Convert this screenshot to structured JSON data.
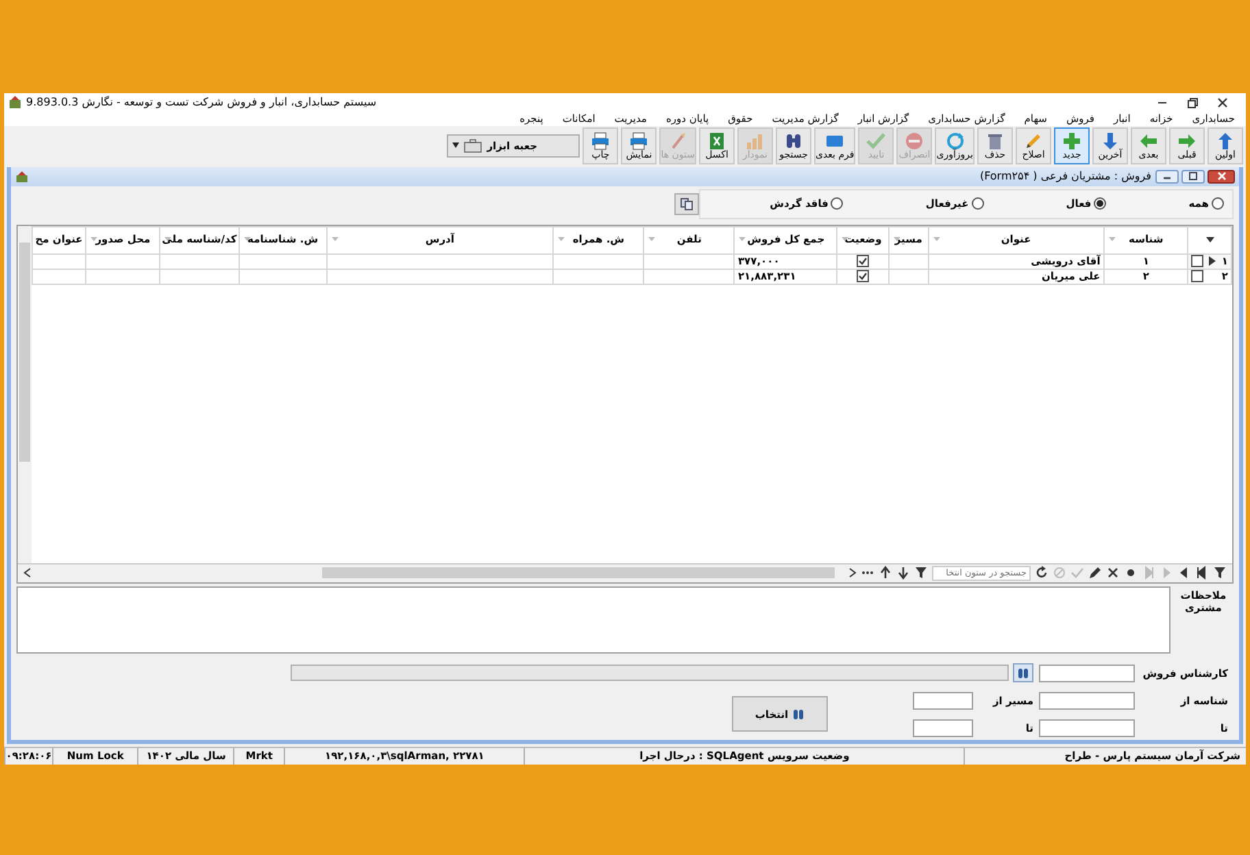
{
  "window": {
    "title": "سیستم حسابداری، انبار و فروش شرکت تست و توسعه - نگارش 9.893.0.3"
  },
  "menu": [
    "حسابداری",
    "خزانه",
    "انبار",
    "فروش",
    "سهام",
    "گزارش حسابداری",
    "گزارش انبار",
    "گزارش مدیریت",
    "حقوق",
    "پایان دوره",
    "مدیریت",
    "امکانات",
    "پنجره"
  ],
  "toolbar": [
    {
      "label": "اولین",
      "disabled": false,
      "selected": false
    },
    {
      "label": "قبلی",
      "disabled": false,
      "selected": false
    },
    {
      "label": "بعدی",
      "disabled": false,
      "selected": false
    },
    {
      "label": "آخرین",
      "disabled": false,
      "selected": false
    },
    {
      "label": "جدید",
      "disabled": false,
      "selected": true
    },
    {
      "label": "اصلاح",
      "disabled": false,
      "selected": false
    },
    {
      "label": "حذف",
      "disabled": false,
      "selected": false
    },
    {
      "label": "بروزآوری",
      "disabled": false,
      "selected": false
    },
    {
      "label": "انصراف",
      "disabled": true,
      "selected": false
    },
    {
      "label": "تایید",
      "disabled": true,
      "selected": false
    },
    {
      "label": "فرم بعدی",
      "disabled": false,
      "selected": false
    },
    {
      "label": "جستجو",
      "disabled": false,
      "selected": false
    },
    {
      "label": "نمودار",
      "disabled": true,
      "selected": false
    },
    {
      "label": "اکسل",
      "disabled": false,
      "selected": false
    },
    {
      "label": "ستون ها",
      "disabled": true,
      "selected": false
    },
    {
      "label": "نمایش",
      "disabled": false,
      "selected": false
    },
    {
      "label": "چاپ",
      "disabled": false,
      "selected": false
    }
  ],
  "toolbox": {
    "label": "جعبه ابزار"
  },
  "form": {
    "title": "فروش : مشتریان فرعی ( Form۲۵۴)",
    "filters": [
      {
        "label": "همه",
        "selected": false
      },
      {
        "label": "فعال",
        "selected": true
      },
      {
        "label": "غیرفعال",
        "selected": false
      },
      {
        "label": "فاقد گردش",
        "selected": false
      }
    ],
    "columns": [
      "شناسه",
      "عنوان",
      "مسیر",
      "وضعیت",
      "جمع کل فروش",
      "تلفن",
      "ش. همراه",
      "آدرس",
      "ش. شناسنامه",
      "کد/شناسه ملی",
      "محل صدور",
      "عنوان مح"
    ],
    "rows": [
      {
        "number": "۱",
        "current": true,
        "checked": false,
        "id": "۱",
        "title": "آقای درویشی",
        "active": true,
        "total": "۳۷۷,۰۰۰"
      },
      {
        "number": "۲",
        "current": false,
        "checked": false,
        "id": "۲",
        "title": "علی میریان",
        "active": true,
        "total": "۲۱,۸۸۳,۲۳۱"
      }
    ],
    "search_placeholder": "جستجو در ستون انتخا",
    "notes_label": "ملاحظات مشتری",
    "fields": {
      "salesperson": "کارشناس فروش",
      "id_from": "شناسه از",
      "id_to": "تا",
      "route_from": "مسیر از",
      "route_to": "تا",
      "select_button": "انتخاب"
    }
  },
  "status_bar": [
    "شرکت آرمان سیستم پارس - طراح",
    "وضعیت سرویس SQLAgent : درحال اجرا",
    "۱۹۲,۱۶۸,۰,۳\\sqlArman, ۲۲۷۸۱",
    "Mrkt",
    "سال مالی ۱۴۰۲",
    "Num Lock",
    "۰۹:۲۸:۰۶"
  ]
}
